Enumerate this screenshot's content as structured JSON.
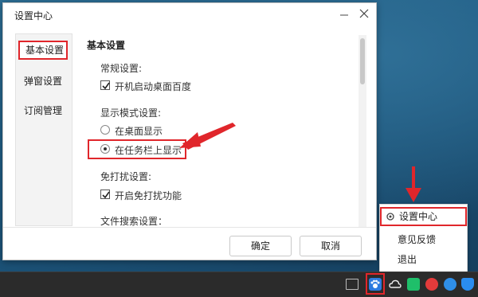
{
  "dialog": {
    "title": "设置中心",
    "close_label": "✕",
    "minimize_label": "—"
  },
  "sidebar": {
    "items": [
      {
        "label": "基本设置",
        "active": true
      },
      {
        "label": "弹窗设置",
        "active": false
      },
      {
        "label": "订阅管理",
        "active": false
      }
    ]
  },
  "content": {
    "section_title": "基本设置",
    "general": {
      "heading": "常规设置:",
      "autostart": {
        "label": "开机启动桌面百度",
        "checked": true
      }
    },
    "display": {
      "heading": "显示模式设置:",
      "options": [
        {
          "label": "在桌面显示",
          "selected": false
        },
        {
          "label": "在任务栏上显示",
          "selected": true
        }
      ]
    },
    "dnd": {
      "heading": "免打扰设置:",
      "enable": {
        "label": "开启免打扰功能",
        "checked": true
      }
    },
    "file_search": {
      "heading": "文件搜索设置："
    }
  },
  "footer": {
    "ok_label": "确定",
    "cancel_label": "取消"
  },
  "tray_menu": {
    "items": [
      {
        "label": "设置中心",
        "icon": "gear-icon",
        "active": true
      },
      {
        "label": "意见反馈",
        "active": false
      },
      {
        "label": "退出",
        "active": false
      }
    ]
  },
  "colors": {
    "highlight": "#e0262b",
    "arrow": "#e0262b"
  }
}
